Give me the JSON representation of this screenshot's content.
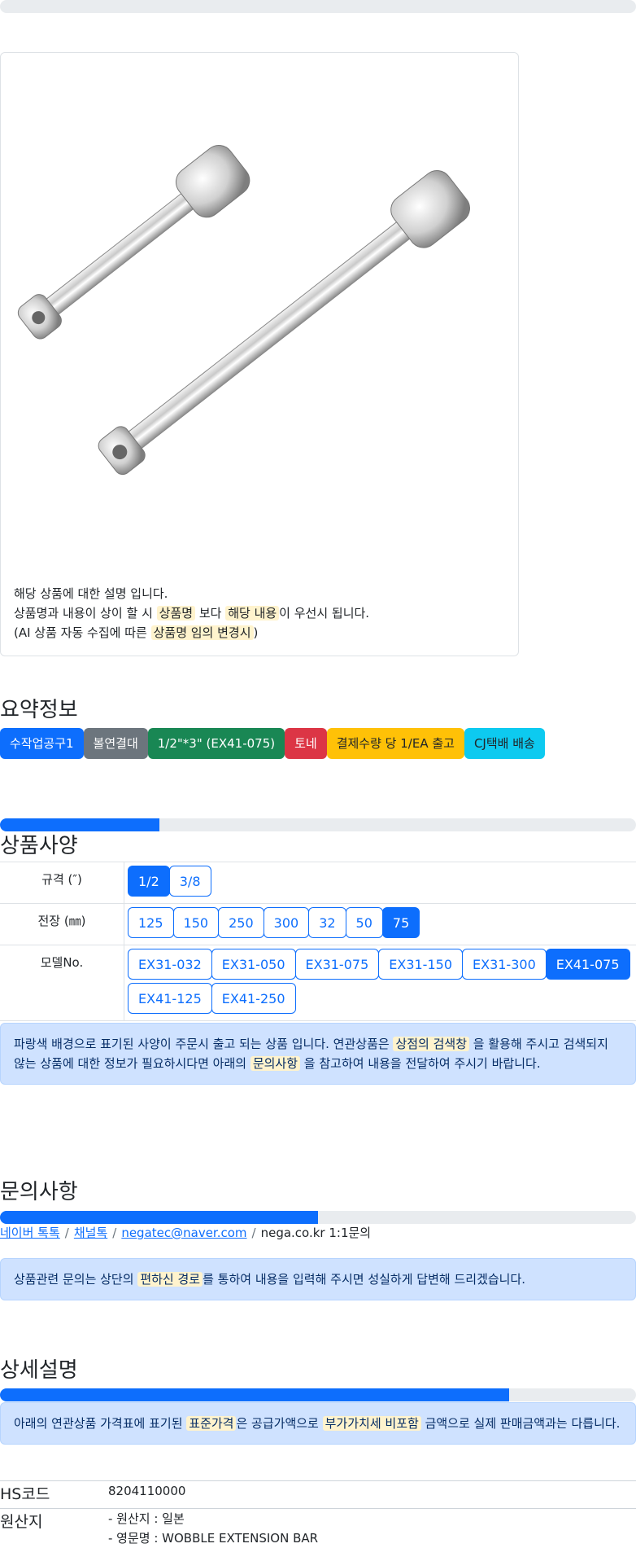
{
  "card": {
    "image_alt": "WOBBLE EXTENSION BAR product photo",
    "notice_line1": "해당 상품에 대한 설명 입니다.",
    "notice_line2_a": "상품명과 내용이 상이 할 시 ",
    "notice_line2_hl1": "상품명",
    "notice_line2_b": " 보다 ",
    "notice_line2_hl2": "해당 내용",
    "notice_line2_c": "이 우선시 됩니다.",
    "notice_line3_a": "(AI 상품 자동 수집에 따른 ",
    "notice_line3_hl": "상품명 임의 변경시",
    "notice_line3_b": ")"
  },
  "summary": {
    "title": "요약정보",
    "badges": [
      {
        "label": "수작업공구1",
        "color": "#0d6efd",
        "text_color": "#ffffff"
      },
      {
        "label": "볼연결대",
        "color": "#6c757d",
        "text_color": "#ffffff"
      },
      {
        "label": "1/2\"*3\" (EX41-075)",
        "color": "#198754",
        "text_color": "#ffffff"
      },
      {
        "label": "토네",
        "color": "#dc3545",
        "text_color": "#ffffff"
      },
      {
        "label": "결제수량 당 1/EA 출고",
        "color": "#ffc107",
        "text_color": "#212529"
      },
      {
        "label": "CJ택배 배송",
        "color": "#0dcaf0",
        "text_color": "#212529"
      }
    ]
  },
  "spec": {
    "title": "상품사양",
    "progress": 0.25,
    "rows": [
      {
        "label": "규격 (″)",
        "options": [
          "1/2",
          "3/8"
        ],
        "selected": [
          0
        ]
      },
      {
        "label": "전장 (㎜)",
        "options": [
          "125",
          "150",
          "250",
          "300",
          "32",
          "50",
          "75"
        ],
        "selected": [
          6
        ]
      },
      {
        "label": "모델No.",
        "options": [
          "EX31-032",
          "EX31-050",
          "EX31-075",
          "EX31-150",
          "EX31-300",
          "EX41-075",
          "EX41-125",
          "EX41-250"
        ],
        "selected": [
          5
        ]
      }
    ],
    "alert_a": "파랑색 배경으로 표기된 사양이 주문시 출고 되는 상품 입니다. 연관상품은 ",
    "alert_hl1": "상점의 검색창",
    "alert_b": " 을 활용해 주시고 검색되지 않는 상품에 대한 정보가 필요하시다면 아래의 ",
    "alert_hl2": "문의사항",
    "alert_c": " 을 참고하여 내용을 전달하여 주시기 바랍니다."
  },
  "inquiry": {
    "title": "문의사항",
    "progress": 0.5,
    "links": [
      "네이버 톡톡",
      "채널톡",
      "negatec@naver.com"
    ],
    "last": "nega.co.kr 1:1문의",
    "alert_a": "상품관련 문의는 상단의 ",
    "alert_hl": "편하신 경로",
    "alert_b": "를 통하여 내용을 입력해 주시면 성실하게 답변해 드리겠습니다."
  },
  "detail": {
    "title": "상세설명",
    "progress": 0.8,
    "alert_a": "아래의 연관상품 가격표에 표기된 ",
    "alert_hl1": "표준가격",
    "alert_b": "은 공급가액으로 ",
    "alert_hl2": "부가가치세 비포함",
    "alert_c": " 금액으로 실제 판매금액과는 다릅니다.",
    "hs_label": "HS코드",
    "hs_value": "8204110000",
    "origin_label": "원산지",
    "origin_line1": "- 원산지 : 일본",
    "origin_line2": "- 영문명 : WOBBLE EXTENSION BAR"
  }
}
